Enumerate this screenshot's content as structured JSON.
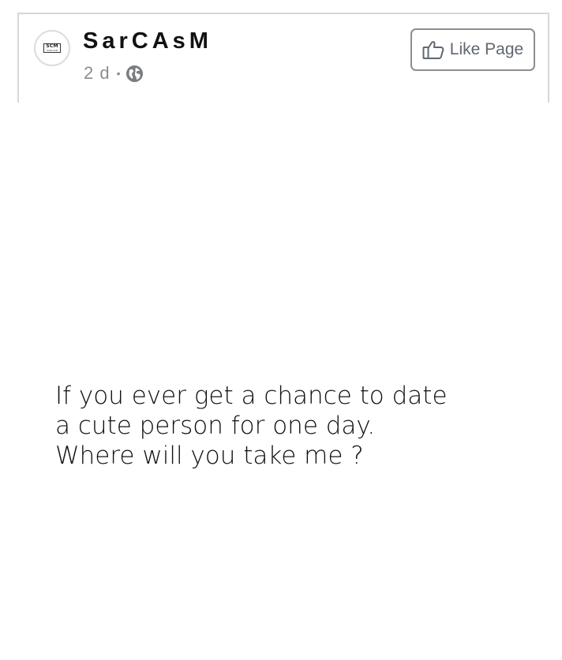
{
  "post": {
    "page_name": "SarCAsM",
    "time": "2 d",
    "separator": "•",
    "privacy_icon": "globe-icon",
    "avatar": {
      "top": "SCM",
      "sub": "SARCASM"
    },
    "like_button": {
      "icon": "thumbs-up-icon",
      "label": "Like Page"
    }
  },
  "image_text": {
    "lines": [
      "If you ever get a chance to date",
      "a cute person for one day.",
      "Where will you take me ?"
    ]
  },
  "colors": {
    "name": "#111111",
    "meta": "#8a8d91",
    "button_border": "#8a8d91",
    "button_text": "#606770",
    "frame_border": "#d7d7d7"
  }
}
